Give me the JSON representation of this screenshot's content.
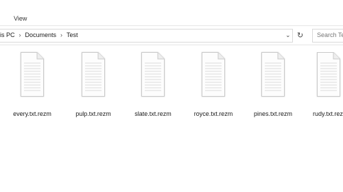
{
  "ribbon": {
    "view_label": "View"
  },
  "address": {
    "crumbs": [
      "is PC",
      "Documents",
      "Test"
    ],
    "dropdown_icon": "chevron-down-icon",
    "refresh_icon": "refresh-icon"
  },
  "search": {
    "placeholder": "Search Te"
  },
  "files": [
    {
      "name": "every.txt.rezm",
      "icon": "text-document-icon"
    },
    {
      "name": "pulp.txt.rezm",
      "icon": "text-document-icon"
    },
    {
      "name": "slate.txt.rezm",
      "icon": "text-document-icon"
    },
    {
      "name": "royce.txt.rezm",
      "icon": "text-document-icon"
    },
    {
      "name": "pines.txt.rezm",
      "icon": "text-document-icon"
    },
    {
      "name": "rudy.txt.rez",
      "icon": "text-document-icon"
    }
  ]
}
